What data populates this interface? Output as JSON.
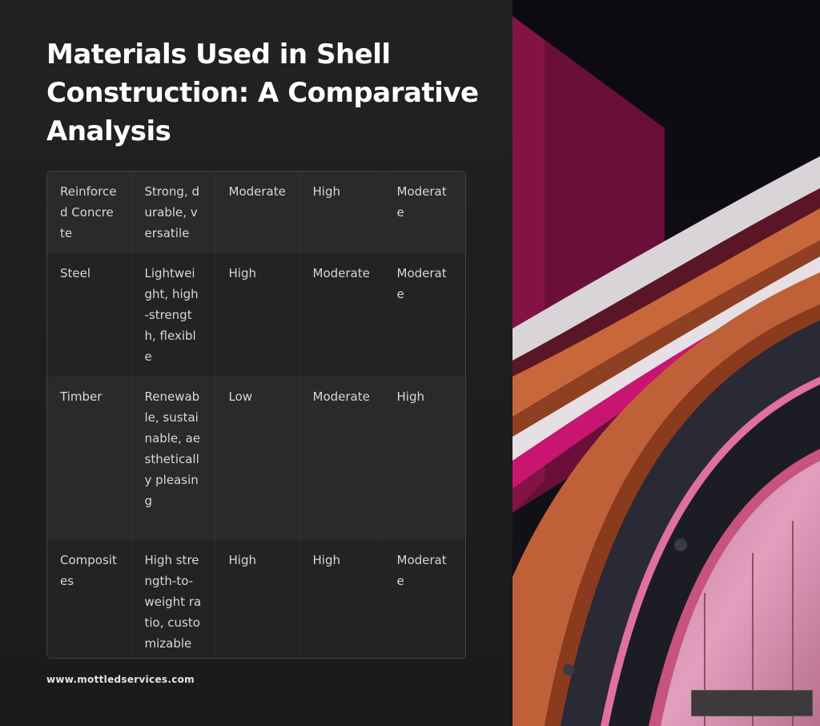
{
  "title": "Materials Used in Shell Construction: A Comparative Analysis",
  "table": {
    "rows": [
      [
        "Reinforced Concrete",
        "Strong, durable, versatile",
        "Moderate",
        "High",
        "Moderate"
      ],
      [
        "Steel",
        "Lightweight, high-strength, flexible",
        "High",
        "Moderate",
        "Moderate"
      ],
      [
        "Timber",
        "Renewable, sustainable, aesthetically pleasing",
        "Low",
        "Moderate",
        "High"
      ],
      [
        "Composites",
        "High strength-to-weight ratio, customizable",
        "High",
        "High",
        "Moderate"
      ]
    ]
  },
  "footer": {
    "url": "www.mottledservices.com"
  },
  "colors": {
    "panel": "#1f1d1d",
    "magenta": "#d11a78",
    "copper": "#c8683a",
    "pink": "#d98aa8"
  }
}
